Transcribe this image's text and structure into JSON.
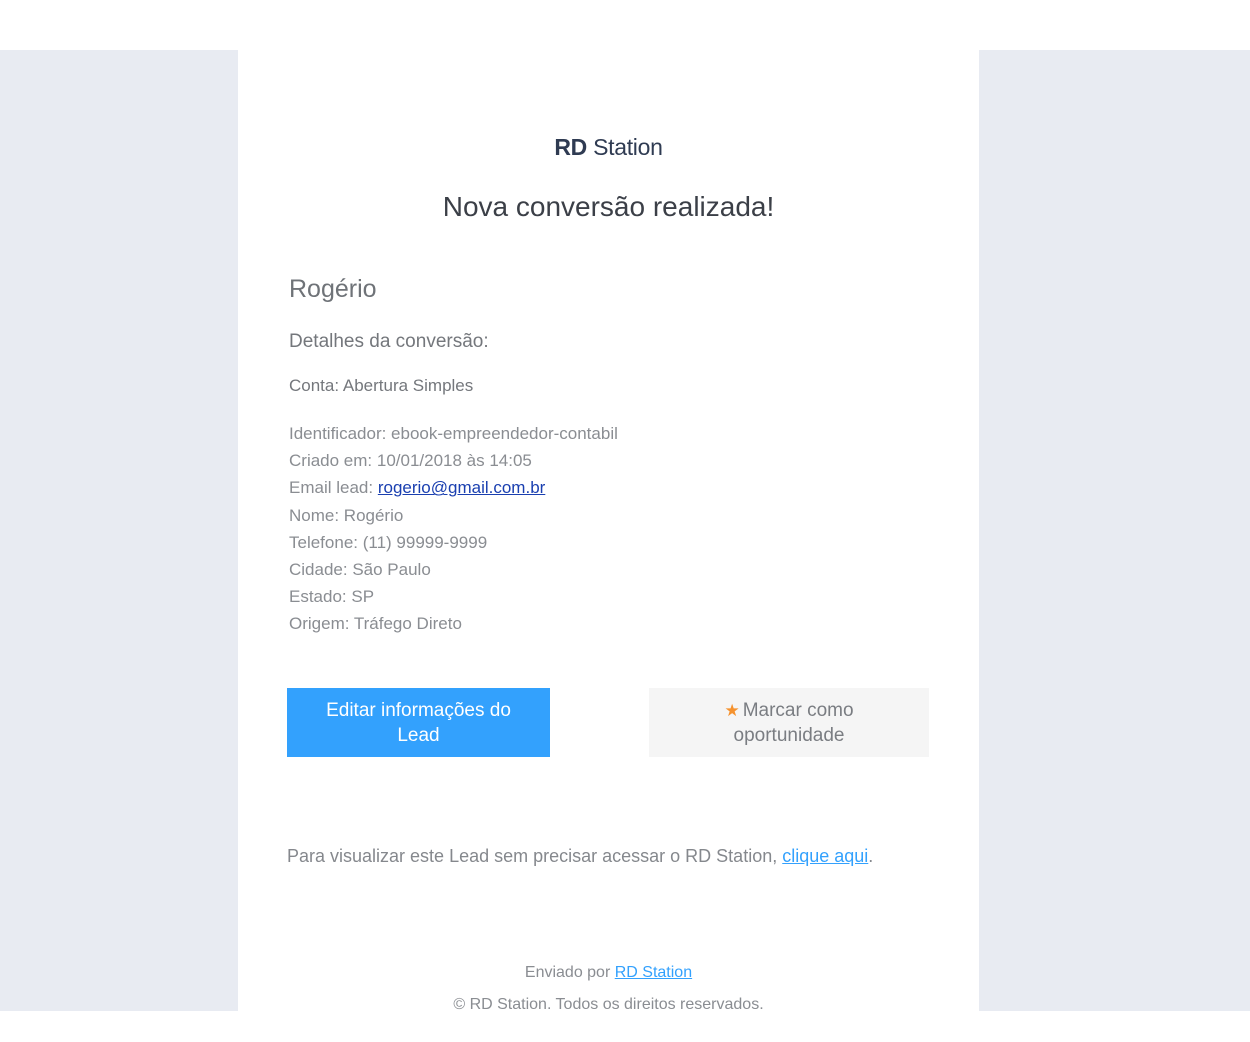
{
  "logo": {
    "bold": "RD",
    "regular": "Station"
  },
  "headline": "Nova conversão realizada!",
  "lead": {
    "name": "Rogério",
    "details_title": "Detalhes da conversão:",
    "account": "Conta: Abertura Simples",
    "fields": {
      "identifier": "Identificador: ebook-empreendedor-contabil",
      "created": "Criado em: 10/01/2018 às 14:05",
      "email_label": "Email lead: ",
      "email_value": "rogerio@gmail.com.br",
      "name": "Nome: Rogério",
      "phone": "Telefone: (11) 99999-9999",
      "city": "Cidade: São Paulo",
      "state": "Estado: SP",
      "origin": "Origem: Tráfego Direto"
    }
  },
  "buttons": {
    "edit_label": "Editar informações do Lead",
    "opportunity_label": "Marcar como oportunidade",
    "opportunity_icon": "star-icon"
  },
  "view_note": {
    "text": "Para visualizar este Lead sem precisar acessar o RD Station, ",
    "link": "clique aqui",
    "end": "."
  },
  "footer": {
    "sent_by_prefix": "Enviado por ",
    "sent_by_link": "RD Station",
    "copyright": "© RD Station. Todos os direitos reservados."
  },
  "colors": {
    "background": "#e8ebf2",
    "primary": "#33a1fd",
    "star": "#f5922e"
  }
}
